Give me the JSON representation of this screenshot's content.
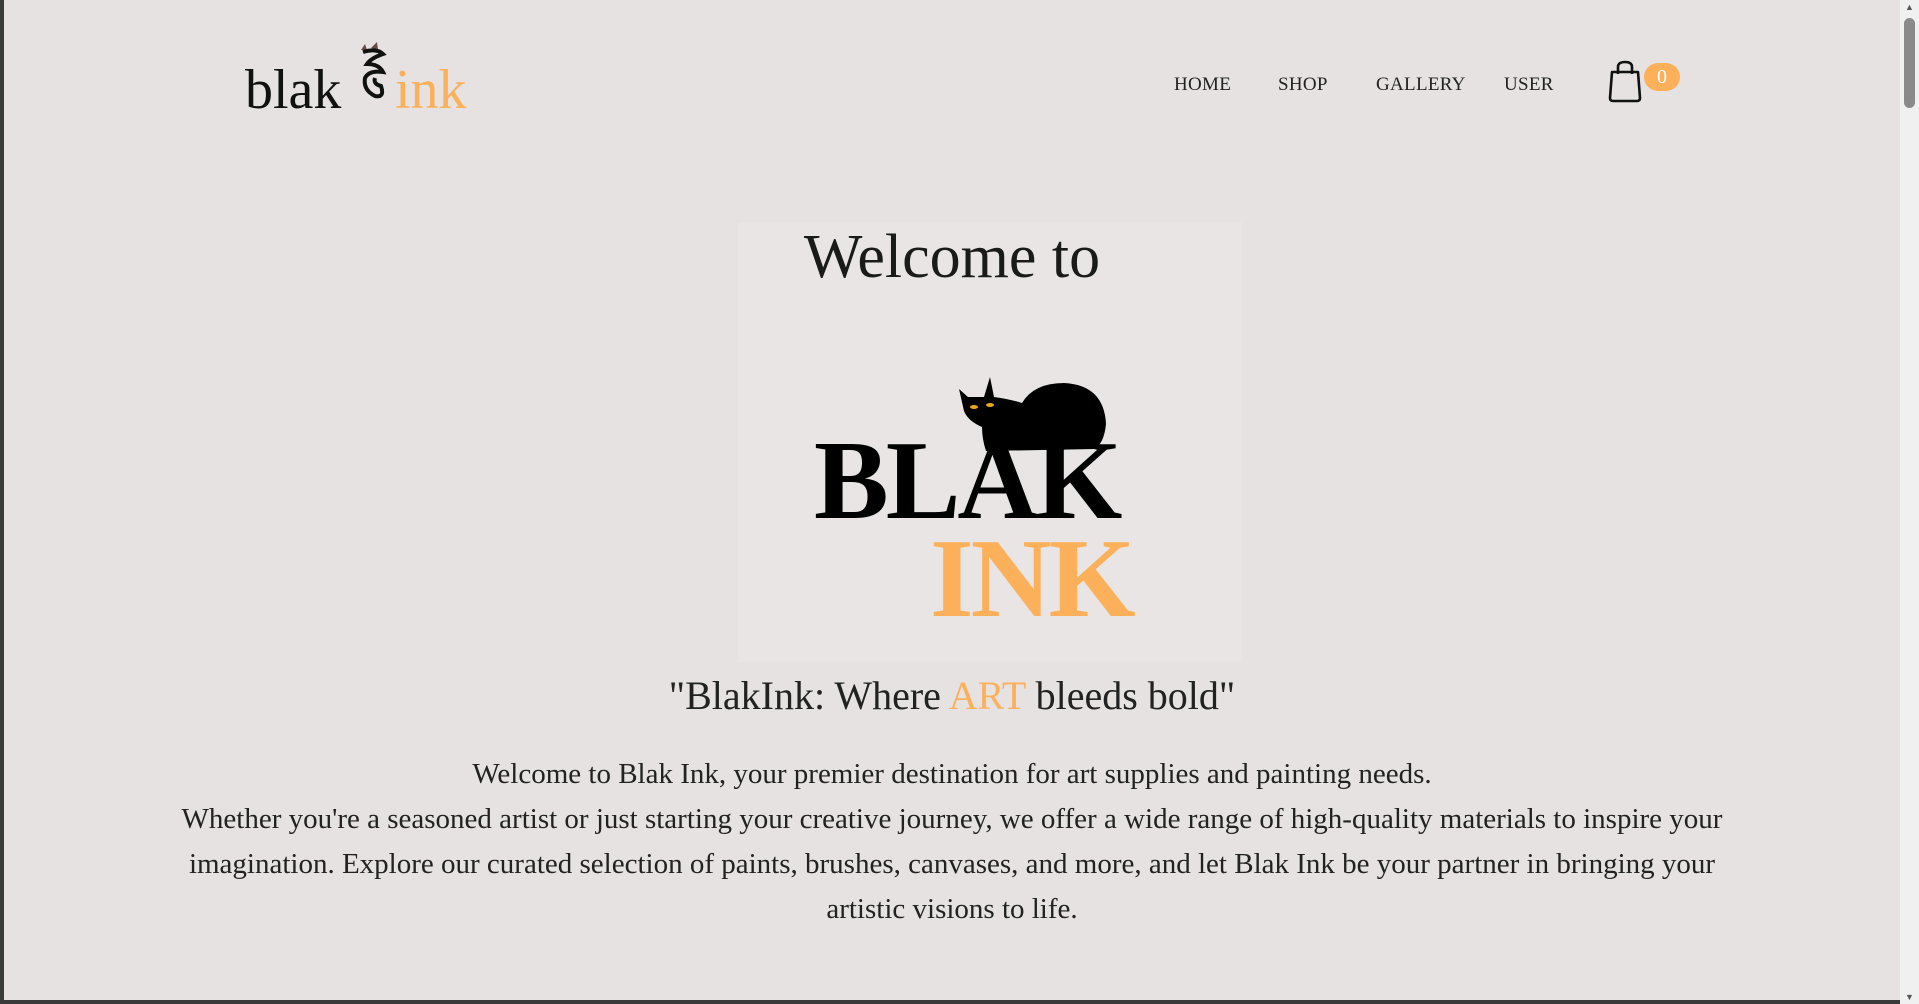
{
  "header": {
    "logo_text_dark": "blak",
    "logo_text_accent": "ink",
    "nav": [
      {
        "label": "HOME"
      },
      {
        "label": "SHOP"
      },
      {
        "label": "GALLERY"
      },
      {
        "label": "USER"
      }
    ],
    "cart_icon": "shopping-bag-icon",
    "cart_count": "0"
  },
  "hero": {
    "welcome": "Welcome to",
    "logo_line1": "BLAK",
    "logo_line2": "INK",
    "tagline_before": "\"BlakInk: Where ",
    "tagline_accent": "ART",
    "tagline_after": " bleeds bold\"",
    "description_line1": "Welcome to Blak Ink, your premier destination for art supplies and painting needs.",
    "description_rest": "Whether you're a seasoned artist or just starting your creative journey, we offer a wide range of high-quality materials to inspire your imagination. Explore our curated selection of paints, brushes, canvases, and more, and let Blak Ink be your partner in bringing your artistic visions to life."
  },
  "colors": {
    "accent": "#fdb05a",
    "background": "#e6e2e1",
    "text": "#222222"
  }
}
